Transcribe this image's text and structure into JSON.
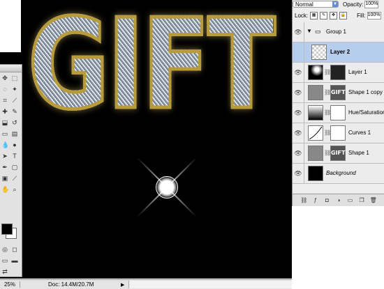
{
  "canvas": {
    "artwork_text": "GIFT"
  },
  "status_bar": {
    "zoom": "25%",
    "doc_size": "Doc: 14.4M/20.7M"
  },
  "toolbox": {
    "type_tool": "T",
    "swatch_fg": "#000000",
    "swatch_bg": "#ffffff"
  },
  "layers_panel": {
    "blend_mode": "Normal",
    "opacity_label": "Opacity:",
    "opacity_value": "100%",
    "lock_label": "Lock:",
    "fill_label": "Fill:",
    "fill_value": "100%",
    "layers": [
      {
        "name": "Group 1",
        "kind": "group",
        "visible": true
      },
      {
        "name": "Layer 2",
        "kind": "transparent",
        "visible": false,
        "selected": true
      },
      {
        "name": "Layer 1",
        "kind": "gradient-mask",
        "visible": true
      },
      {
        "name": "Shape 1 copy",
        "kind": "shape",
        "visible": true,
        "thumb_text": "GIFT"
      },
      {
        "name": "Hue/Saturation 1",
        "kind": "adjustment",
        "visible": true
      },
      {
        "name": "Curves 1",
        "kind": "adjustment",
        "visible": true
      },
      {
        "name": "Shape 1",
        "kind": "shape",
        "visible": true,
        "thumb_text": "GIFT"
      },
      {
        "name": "Background",
        "kind": "background",
        "visible": true
      }
    ]
  }
}
